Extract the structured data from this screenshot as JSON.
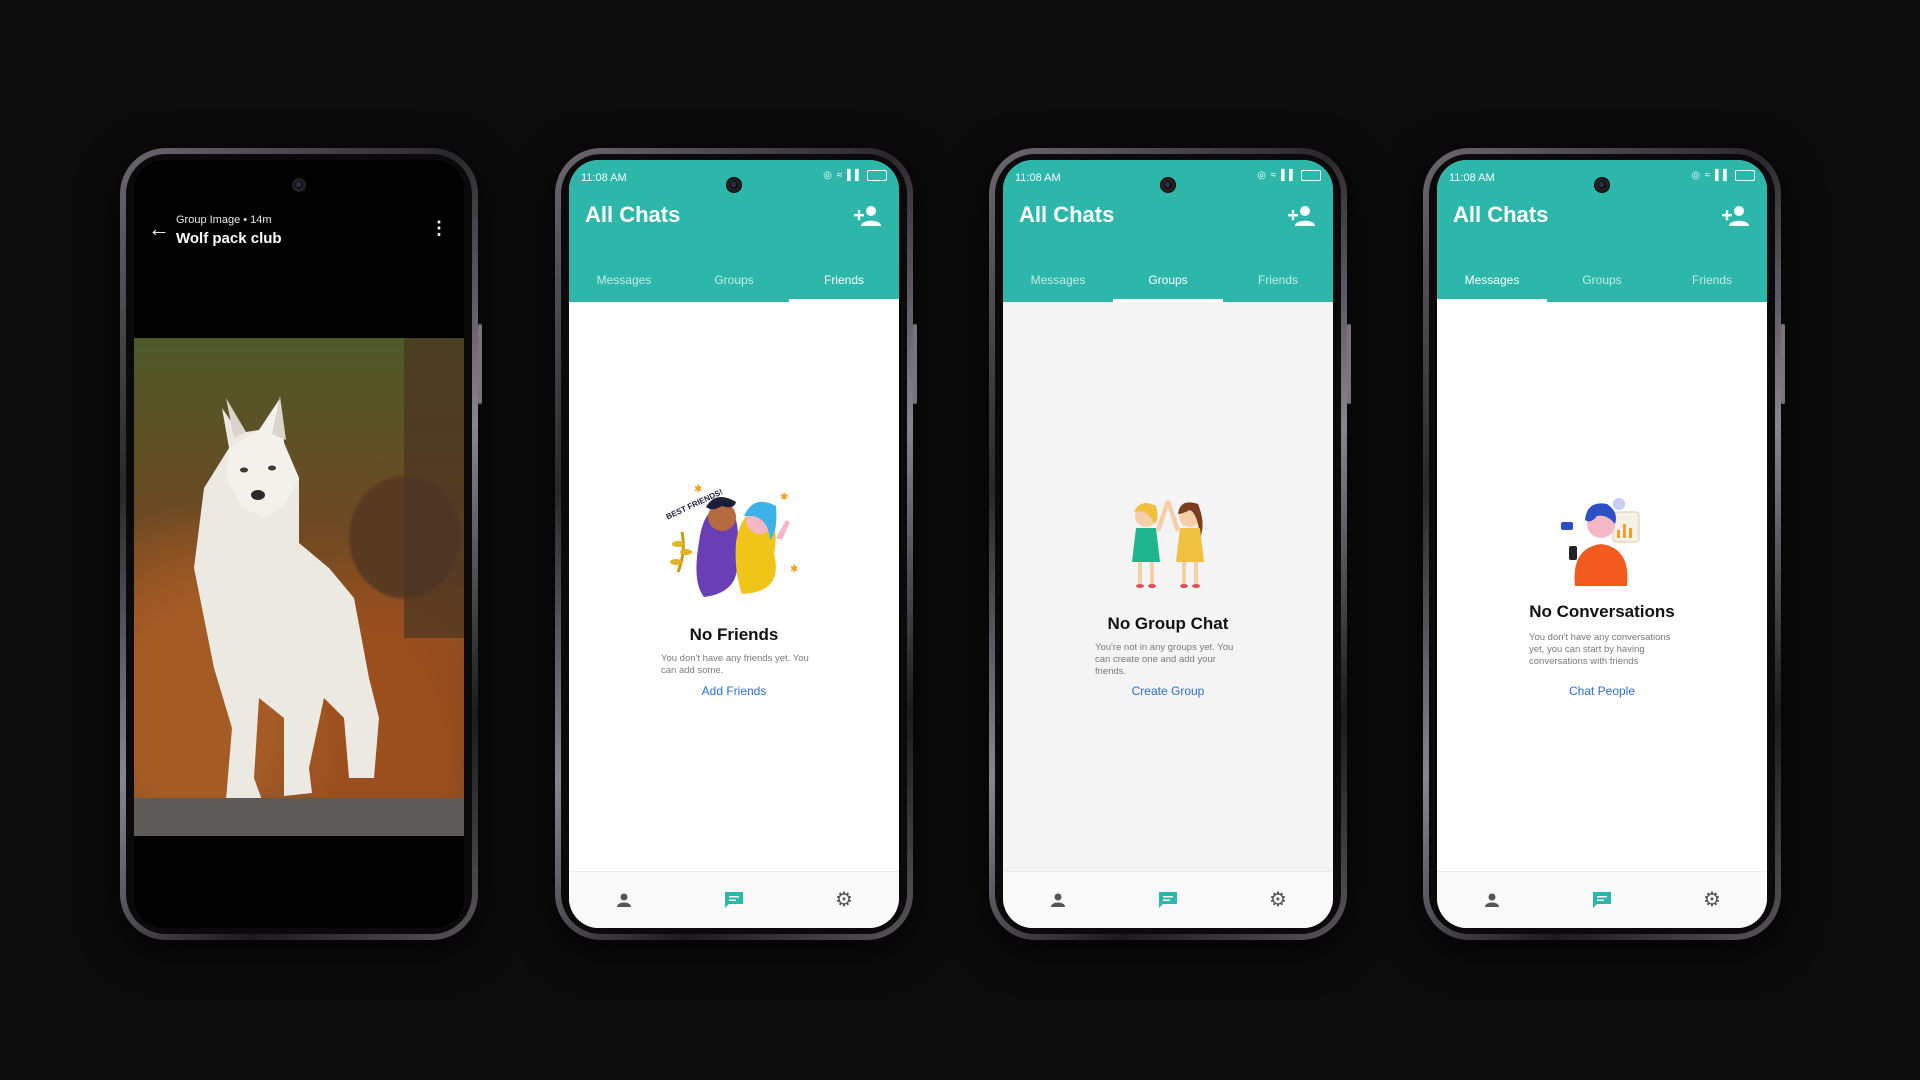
{
  "viewer": {
    "subtitle": "Group Image • 14m",
    "group_name": "Wolf pack club"
  },
  "app": {
    "status_time": "11:08 AM",
    "title": "All Chats",
    "tabs": [
      "Messages",
      "Groups",
      "Friends"
    ],
    "colors": {
      "accent": "#2db7aa",
      "link": "#2b6fd1",
      "nav_active": "#2db7aa",
      "nav_inactive": "#555555"
    }
  },
  "screens": {
    "friends": {
      "empty_title": "No Friends",
      "empty_body": "You don't have any friends yet. You can add some.",
      "action": "Add Friends",
      "sticker_text": "BEST FRIENDS!"
    },
    "groups": {
      "empty_title": "No Group Chat",
      "empty_body": "You're not in any groups yet. You can create one and add your friends.",
      "action": "Create Group"
    },
    "messages": {
      "empty_title": "No Conversations",
      "empty_body": "You don't have any conversations yet, you can start by having conversations with friends",
      "action": "Chat People"
    }
  },
  "icons": [
    "back-arrow-icon",
    "more-vert-icon",
    "add-person-icon",
    "person-icon",
    "chat-icon",
    "settings-gear-icon"
  ]
}
